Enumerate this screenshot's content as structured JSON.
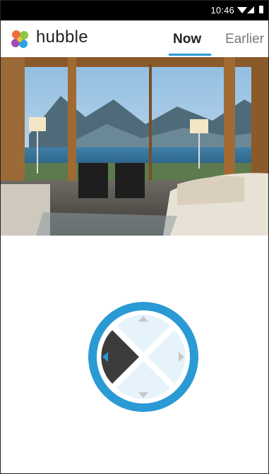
{
  "status_bar": {
    "time": "10:46"
  },
  "app": {
    "brand": "hubble"
  },
  "tabs": [
    {
      "label": "Now",
      "active": true
    },
    {
      "label": "Earlier",
      "active": false
    }
  ],
  "controls": [
    {
      "name": "pan-tilt-control",
      "icon": "crosshair-icon",
      "active": true
    },
    {
      "name": "microphone-control",
      "icon": "microphone-icon",
      "active": false
    },
    {
      "name": "snapshot-control",
      "icon": "camera-icon",
      "active": false
    },
    {
      "name": "lullaby-control",
      "icon": "music-note-icon",
      "active": false
    },
    {
      "name": "temperature-control",
      "icon": "thermometer-icon",
      "active": false
    }
  ],
  "dpad": {
    "pressed": "left"
  },
  "colors": {
    "accent": "#2a9ad5",
    "pad_light": "#e6f3fb",
    "pad_pressed": "#3c3c3c"
  }
}
